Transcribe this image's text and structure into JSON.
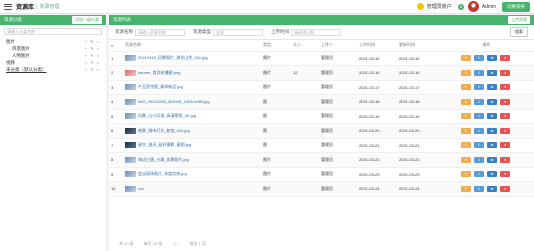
{
  "topbar": {
    "logo": "资源库",
    "sep": "|",
    "crumb": "资源管理",
    "user": "管理员账户",
    "badge": "5",
    "avatar_name": "Admin",
    "action": "切换系统"
  },
  "left": {
    "title": "资源分类",
    "add": "添加一级分类",
    "search_placeholder": "请输入分类名称",
    "tree": [
      {
        "label": "图片",
        "ops": "+ ✎ ×",
        "child": false,
        "active": false
      },
      {
        "label": "风景图片",
        "ops": "+ ✎ ×",
        "child": true,
        "active": false
      },
      {
        "label": "人物图片",
        "ops": "+ ✎ ×",
        "child": true,
        "active": false
      },
      {
        "label": "视频",
        "ops": "+ ✎ ×",
        "child": false,
        "active": false
      },
      {
        "label": "未分类（默认分类）",
        "ops": "+ ✎ ×",
        "child": false,
        "active": true
      }
    ]
  },
  "main": {
    "title": "资源列表",
    "upload": "上传资源",
    "filters": [
      {
        "label": "资源名称",
        "placeholder": "请输入资源名称"
      },
      {
        "label": "资源类型",
        "placeholder": "全部"
      },
      {
        "label": "上传时间",
        "placeholder": "请选择日期"
      }
    ],
    "search": "搜索",
    "columns": [
      "#",
      "资源名称",
      "类型",
      "大小",
      "上传人",
      "上传时间",
      "更新时间",
      "操作"
    ],
    "rows": [
      {
        "no": "1",
        "thumb": "",
        "name": "20210315_风景图片_湖光山色_001.jpg",
        "type": "图片",
        "size": "",
        "user": "管理员",
        "t1": "2021-03-15",
        "t2": "2021-03-15"
      },
      {
        "no": "2",
        "thumb": "red",
        "name": "banner_首页轮播图.png",
        "type": "图片",
        "size": "12",
        "user": "管理员",
        "t1": "2021-03-16",
        "t2": "2021-03-16"
      },
      {
        "no": "3",
        "thumb": "",
        "name": "产品宣传图_春季新品.jpg",
        "type": "图片",
        "size": "",
        "user": "管理员",
        "t1": "2021-03-17",
        "t2": "2021-03-17"
      },
      {
        "no": "4",
        "thumb": "",
        "name": "IMG_20210318_093045_1920x1080.jpg",
        "type": "图",
        "size": "",
        "user": "管理员",
        "t1": "2021-03-18",
        "t2": "2021-03-18"
      },
      {
        "no": "5",
        "thumb": "",
        "name": "风景_山川河流_高清壁纸_4K.jpg",
        "type": "图",
        "size": "",
        "user": "管理员",
        "t1": "2021-03-19",
        "t2": "2021-03-19"
      },
      {
        "no": "6",
        "thumb": "dark",
        "name": "夜景_城市灯光_航拍_003.jpg",
        "type": "图",
        "size": "",
        "user": "管理员",
        "t1": "2021-03-20",
        "t2": "2021-03-20"
      },
      {
        "no": "7",
        "thumb": "dark",
        "name": "星空_银河_延时摄影_截图.jpg",
        "type": "图",
        "size": "",
        "user": "管理员",
        "t1": "2021-03-21",
        "t2": "2021-03-21"
      },
      {
        "no": "8",
        "thumb": "",
        "name": "海边日落_沙滩_风景照片.jpg",
        "type": "图片",
        "size": "",
        "user": "管理员",
        "t1": "2021-03-22",
        "t2": "2021-03-22"
      },
      {
        "no": "9",
        "thumb": "",
        "name": "会议现场照片_年度总结.jpg",
        "type": "图片",
        "size": "",
        "user": "管理员",
        "t1": "2021-03-23",
        "t2": "2021-03-23"
      },
      {
        "no": "10",
        "thumb": "",
        "name": "xxx",
        "type": "图片",
        "size": "",
        "user": "管理员",
        "t1": "2021-03-24",
        "t2": "2021-03-24"
      }
    ],
    "actions": {
      "edit": "✎",
      "view": "⇩",
      "move": "⇄",
      "del": "✕"
    },
    "pager": [
      "共 10 条",
      "每页 10 条",
      "‹ 1 ›",
      "前往 1 页"
    ]
  }
}
